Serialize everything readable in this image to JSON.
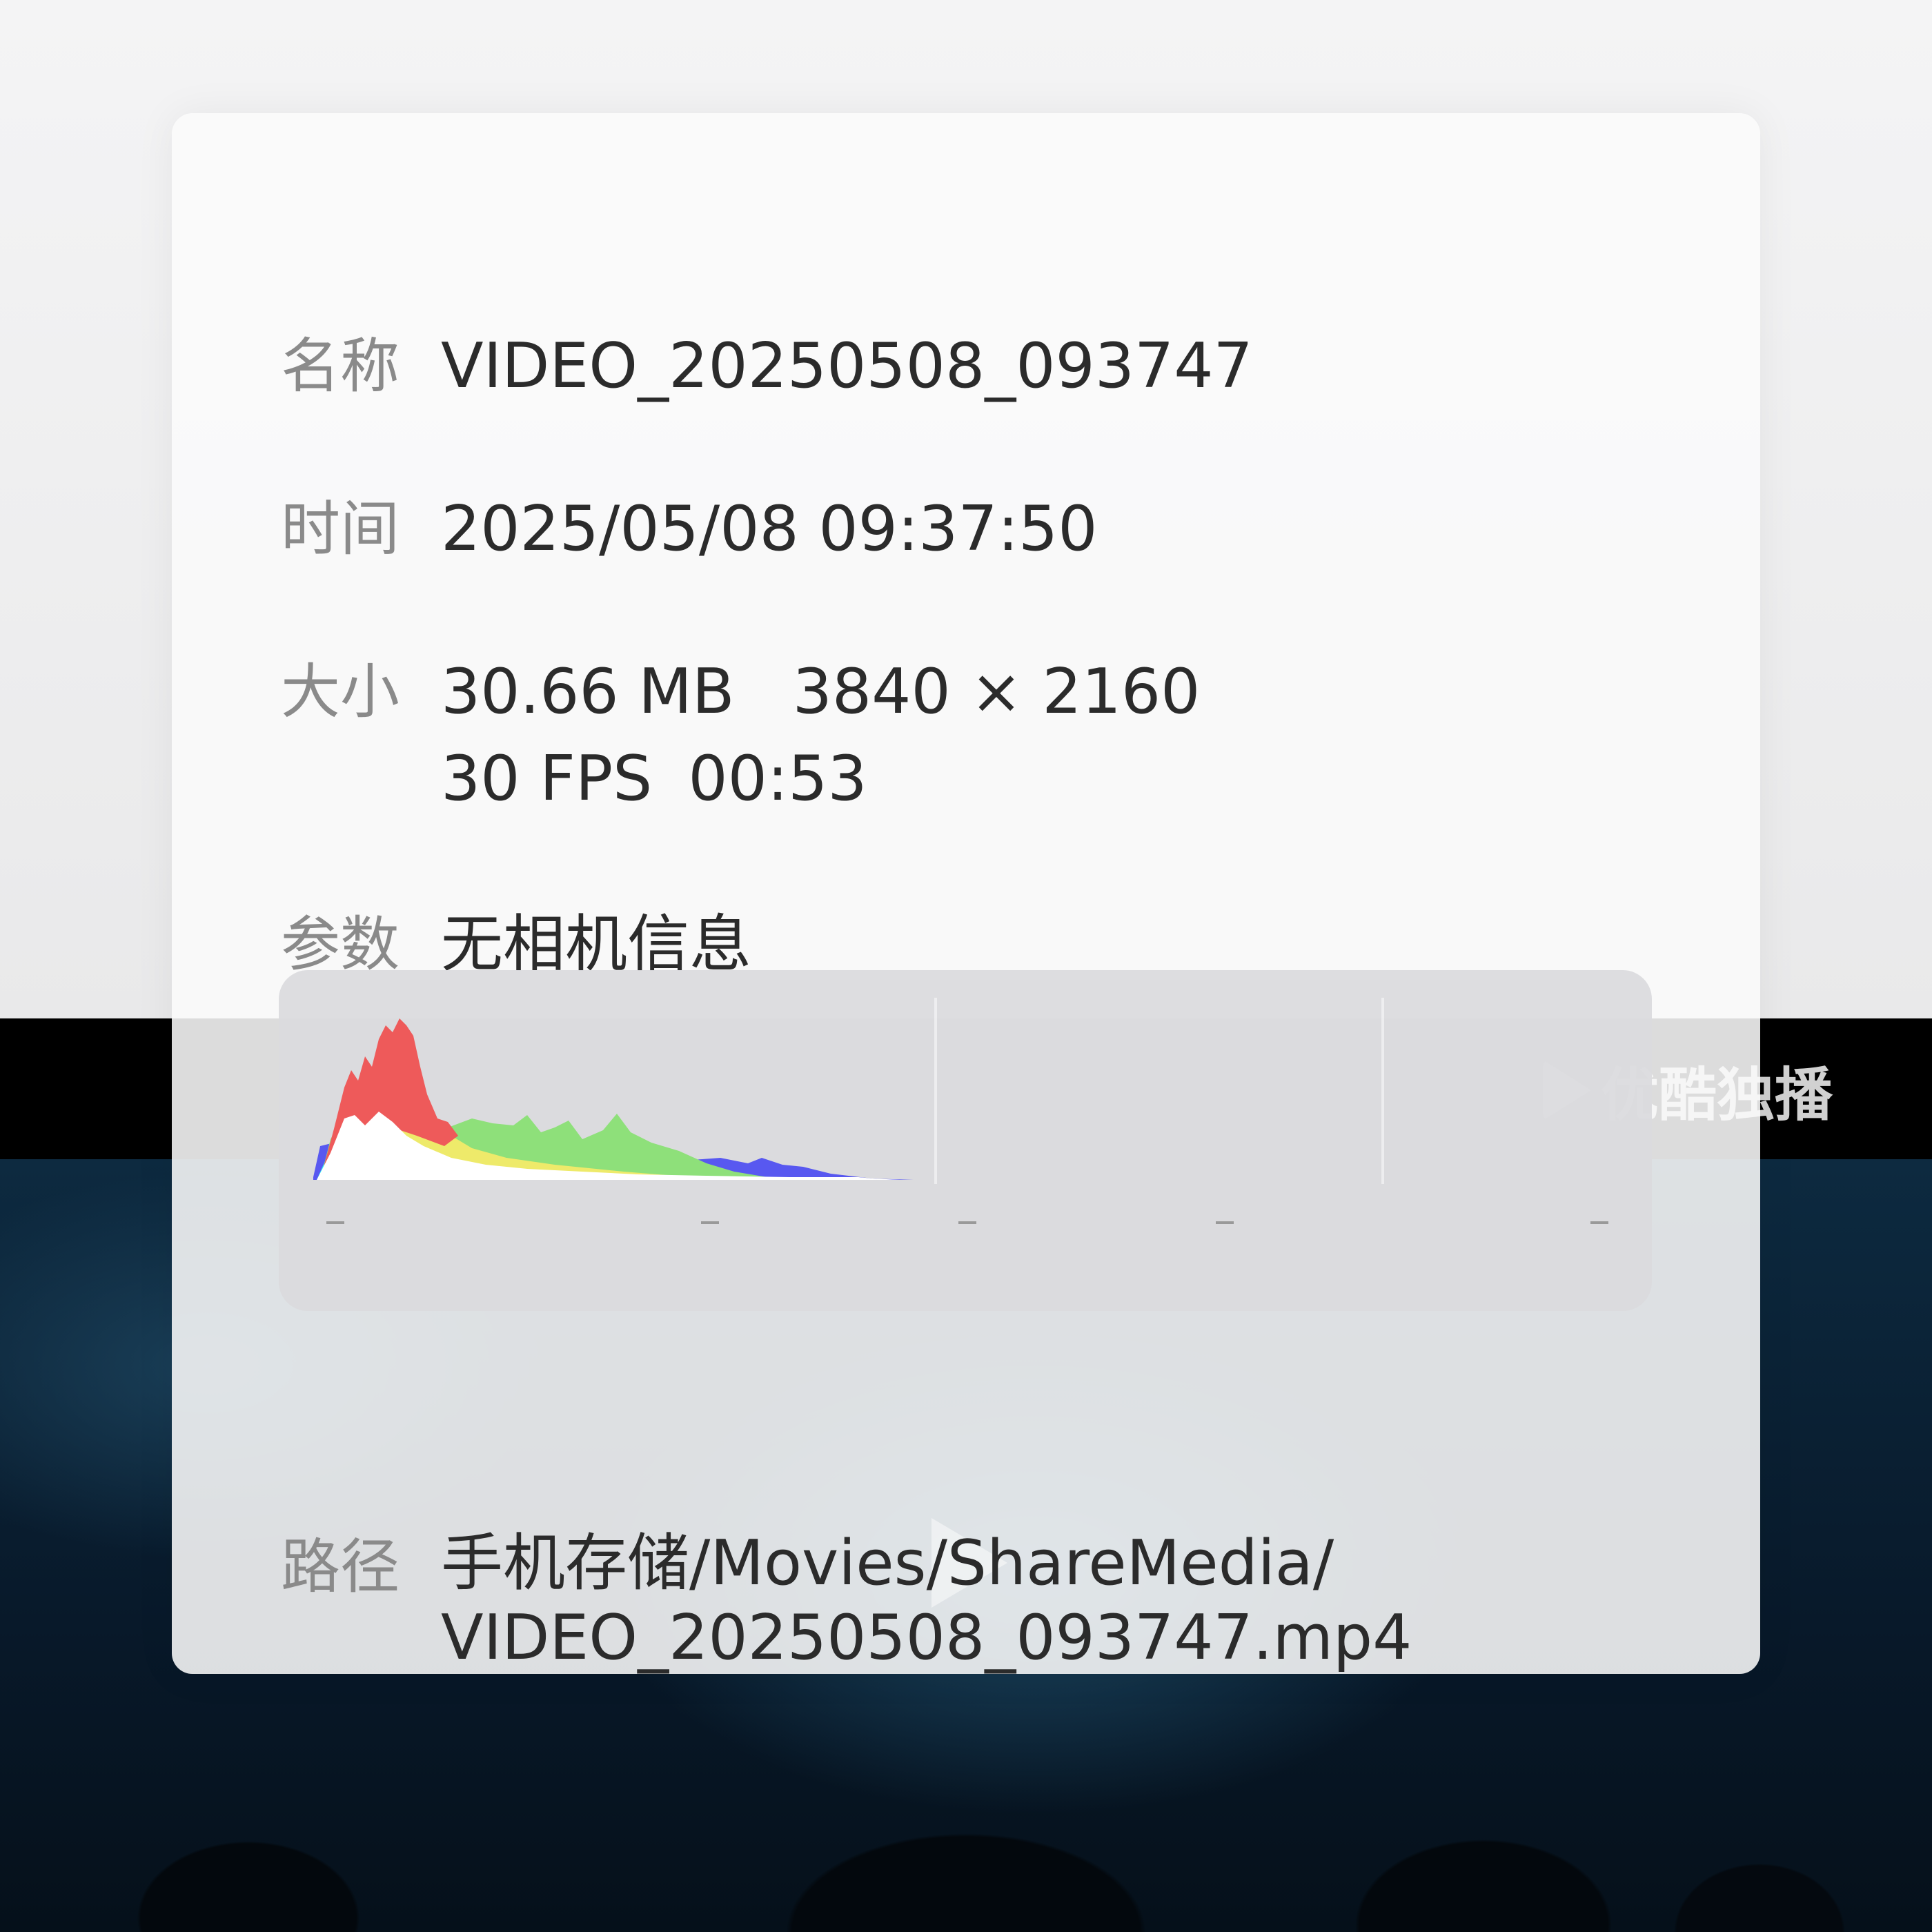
{
  "details": {
    "name": {
      "label": "名称",
      "value": "VIDEO_20250508_093747"
    },
    "time": {
      "label": "时间",
      "value": "2025/05/08 09:37:50"
    },
    "size": {
      "label": "大小",
      "file_size": "30.66 MB",
      "resolution": "3840 × 2160",
      "fps": "30 FPS",
      "duration": "00:53"
    },
    "params": {
      "label": "参数",
      "value": "无相机信息"
    },
    "path": {
      "label": "路径",
      "line1": "手机存储/Movies/ShareMedia/",
      "line2": "VIDEO_20250508_093747.mp4"
    },
    "histogram_axis_marks": [
      "-",
      "-",
      "-",
      "-",
      "-"
    ]
  },
  "background": {
    "watermark_text": "优酷独播",
    "icons": [
      "youku-logo-icon",
      "play-icon"
    ]
  },
  "colors": {
    "histogram_red": "#ee5a5a",
    "histogram_yellow": "#eeea6a",
    "histogram_green": "#8ee07a",
    "histogram_cyan": "#28f0f0",
    "histogram_blue": "#5858f0",
    "histogram_white": "#ffffff"
  }
}
